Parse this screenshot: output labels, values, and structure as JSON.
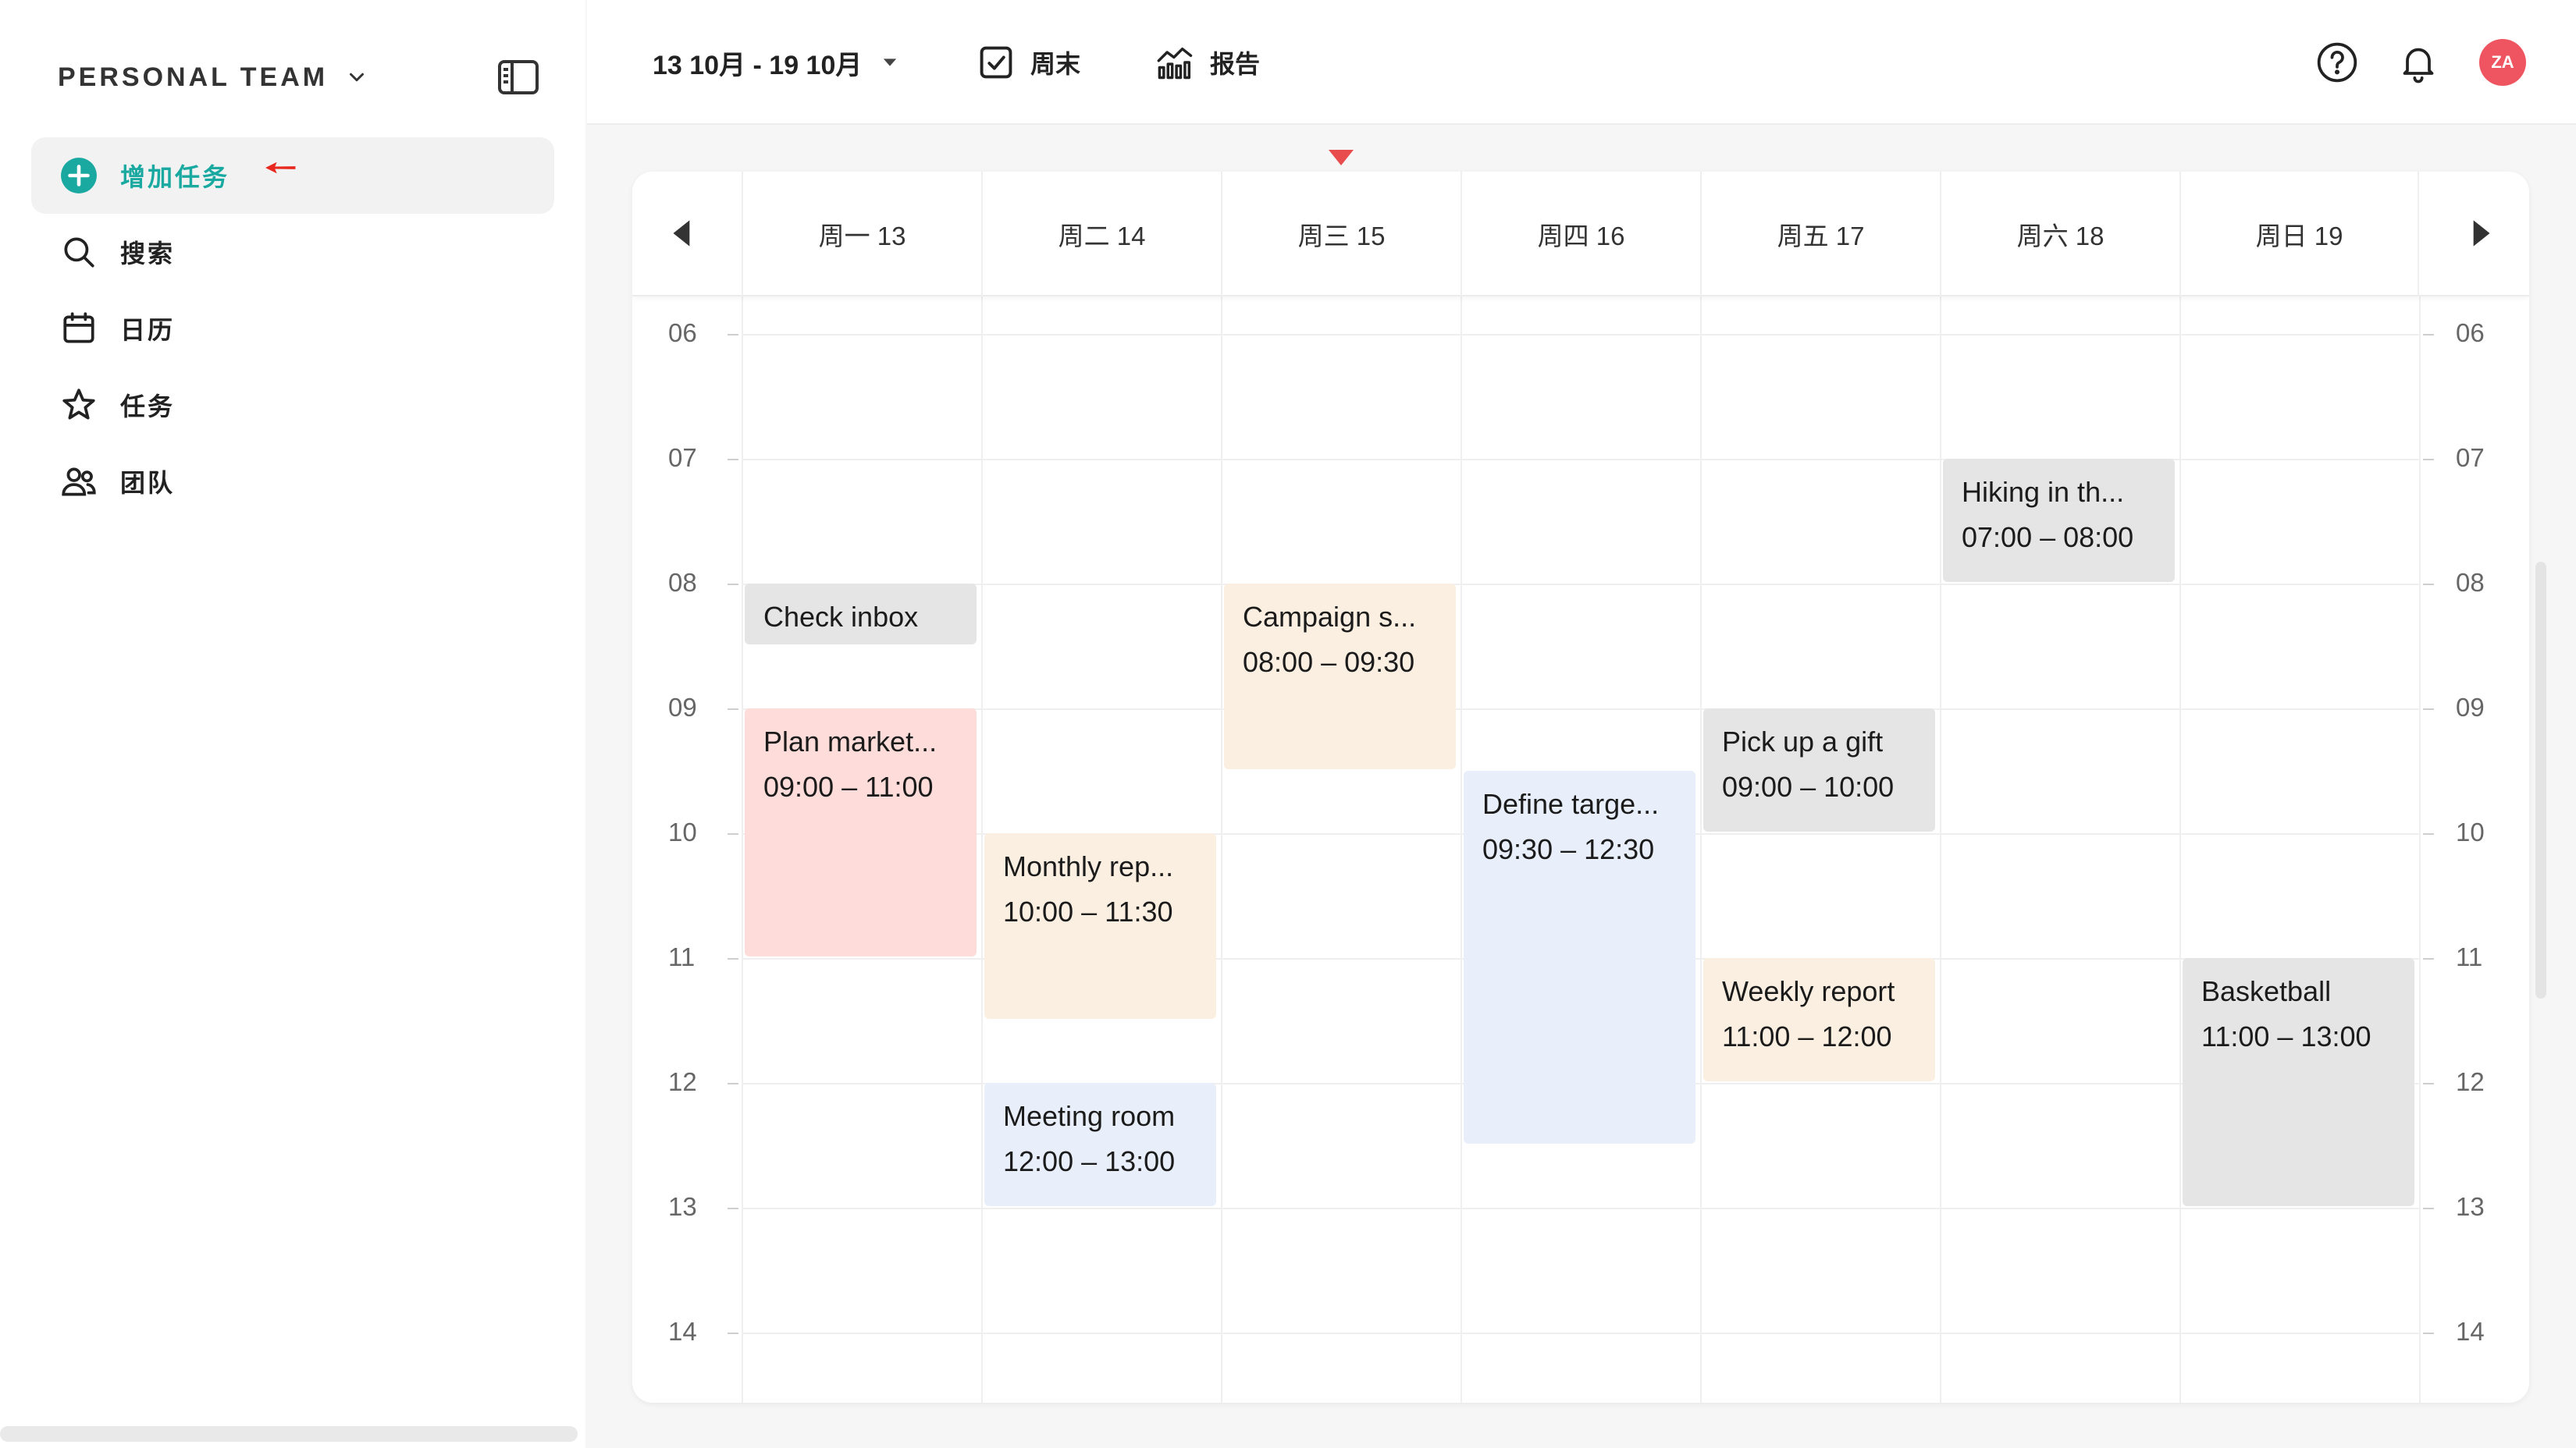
{
  "sidebar": {
    "team_name": "PERSONAL TEAM",
    "nav": [
      {
        "label": "增加任务",
        "icon": "plus-circle-icon",
        "active": true
      },
      {
        "label": "搜索",
        "icon": "search-icon"
      },
      {
        "label": "日历",
        "icon": "calendar-icon"
      },
      {
        "label": "任务",
        "icon": "star-icon"
      },
      {
        "label": "团队",
        "icon": "team-icon"
      }
    ]
  },
  "topbar": {
    "date_range": "13 10月 - 19 10月",
    "weekend_label": "周末",
    "report_label": "报告",
    "avatar_initials": "ZA"
  },
  "calendar": {
    "days": [
      "周一 13",
      "周二 14",
      "周三 15",
      "周四 16",
      "周五 17",
      "周六 18",
      "周日 19"
    ],
    "hours": [
      "06",
      "07",
      "08",
      "09",
      "10",
      "11",
      "12",
      "13",
      "14"
    ],
    "events": [
      {
        "day": 0,
        "start": 8.0,
        "end": 8.5,
        "title": "Check inbox",
        "time": "",
        "color": "gray"
      },
      {
        "day": 0,
        "start": 9.0,
        "end": 11.0,
        "title": "Plan market...",
        "time": "09:00 – 11:00",
        "color": "pink"
      },
      {
        "day": 1,
        "start": 10.0,
        "end": 11.5,
        "title": "Monthly rep...",
        "time": "10:00 – 11:30",
        "color": "peach"
      },
      {
        "day": 1,
        "start": 12.0,
        "end": 13.0,
        "title": "Meeting room",
        "time": "12:00 – 13:00",
        "color": "blue"
      },
      {
        "day": 2,
        "start": 8.0,
        "end": 9.5,
        "title": "Campaign s...",
        "time": "08:00 – 09:30",
        "color": "peach"
      },
      {
        "day": 3,
        "start": 9.5,
        "end": 12.5,
        "title": "Define targe...",
        "time": "09:30 – 12:30",
        "color": "blue"
      },
      {
        "day": 4,
        "start": 9.0,
        "end": 10.0,
        "title": "Pick up a gift",
        "time": "09:00 – 10:00",
        "color": "gray"
      },
      {
        "day": 4,
        "start": 11.0,
        "end": 12.0,
        "title": "Weekly report",
        "time": "11:00 – 12:00",
        "color": "peach"
      },
      {
        "day": 5,
        "start": 7.0,
        "end": 8.0,
        "title": "Hiking in th...",
        "time": "07:00 – 08:00",
        "color": "gray"
      },
      {
        "day": 6,
        "start": 11.0,
        "end": 13.0,
        "title": "Basketball",
        "time": "11:00 – 13:00",
        "color": "gray"
      }
    ]
  },
  "colors": {
    "accent": "#19a9a0",
    "arrow_red": "#e8281e",
    "avatar": "#ef5560"
  }
}
